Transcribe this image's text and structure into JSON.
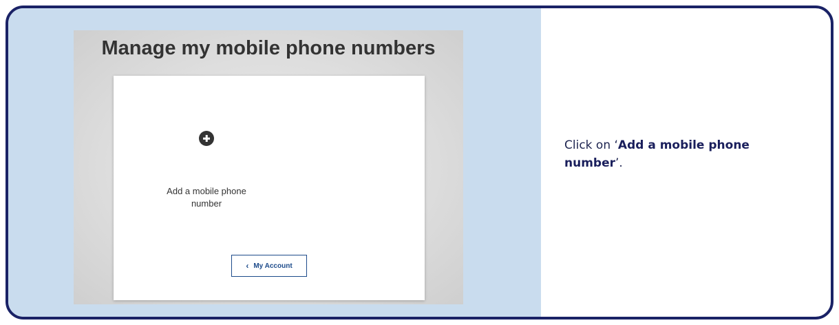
{
  "screenshot": {
    "title": "Manage my mobile phone numbers",
    "add_item": {
      "icon": "plus-circle-icon",
      "label": "Add a mobile phone number"
    },
    "account_button": {
      "icon": "chevron-left-icon",
      "label": "My Account"
    }
  },
  "instruction": {
    "prefix": "Click on ‘",
    "emphasis": "Add a mobile phone number",
    "suffix": "’."
  },
  "colors": {
    "frame_border": "#1a2266",
    "panel_background": "#c9dcee",
    "button_accent": "#1c4a8a"
  }
}
